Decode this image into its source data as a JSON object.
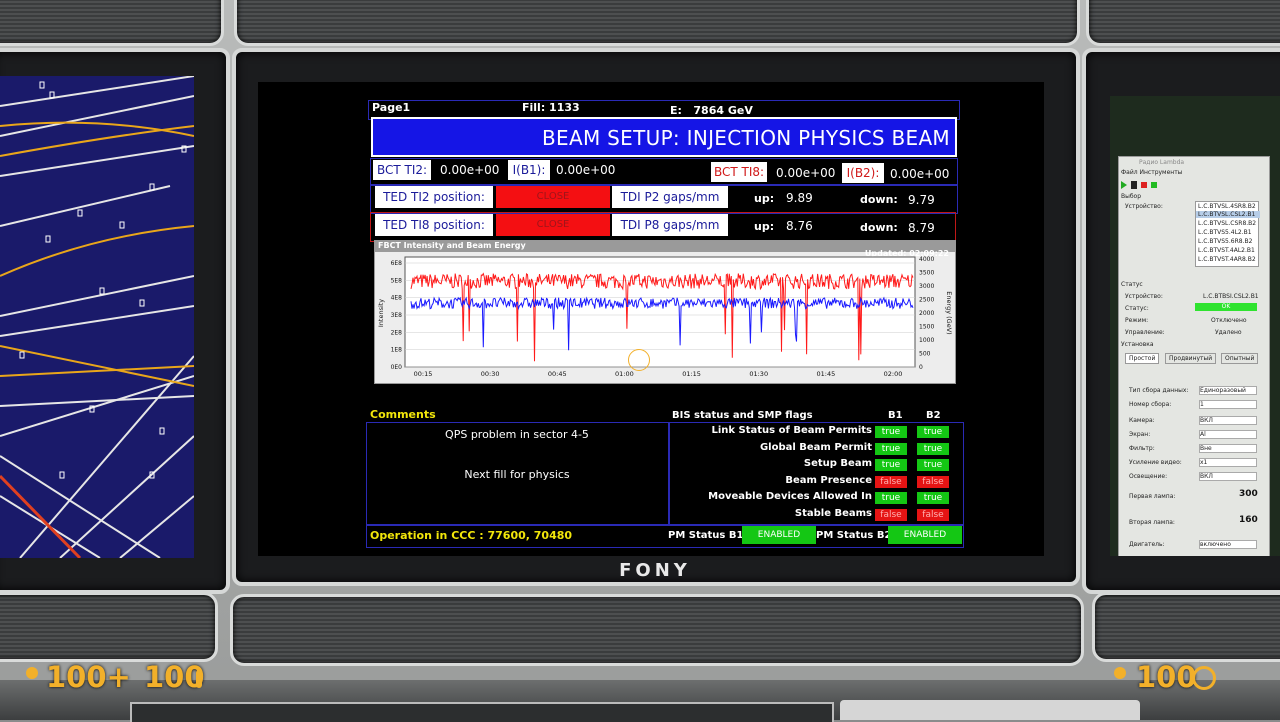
{
  "header": {
    "page": "Page1",
    "fill": "Fill: 1133",
    "energy": "E:   7864 GeV"
  },
  "title": "BEAM SETUP: INJECTION PHYSICS BEAM",
  "bct": {
    "ti2_label": "BCT TI2:",
    "ti2_value": "0.00e+00",
    "ib1_label": "I(B1):",
    "ib1_value": "0.00e+00",
    "ti8_label": "BCT TI8:",
    "ti8_value": "0.00e+00",
    "ib2_label": "I(B2):",
    "ib2_value": "0.00e+00"
  },
  "ted": {
    "ti2_label": "TED TI2 position:",
    "ti2_state": "CLOSE",
    "ti8_label": "TED TI8 position:",
    "ti8_state": "CLOSE",
    "tdi_p2_label": "TDI P2 gaps/mm",
    "tdi_p2_up_label": "up:",
    "tdi_p2_up": "9.89",
    "tdi_p2_down_label": "down:",
    "tdi_p2_down": "9.79",
    "tdi_p8_label": "TDI P8 gaps/mm",
    "tdi_p8_up_label": "up:",
    "tdi_p8_up": "8.76",
    "tdi_p8_down_label": "down:",
    "tdi_p8_down": "8.79"
  },
  "chart_data": {
    "type": "line",
    "title": "FBCT Intensity and Beam Energy",
    "updated": "Updated: 02:09:22",
    "ylabel": "Intensity",
    "y2label": "Energy (GeV)",
    "x_ticks": [
      "00:15",
      "00:30",
      "00:45",
      "01:00",
      "01:15",
      "01:30",
      "01:45",
      "02:00"
    ],
    "y_ticks": [
      "0E0",
      "1E8",
      "2E8",
      "3E8",
      "4E8",
      "5E8",
      "6E8"
    ],
    "y2_ticks": [
      "0",
      "500",
      "1000",
      "1500",
      "2000",
      "2500",
      "3000",
      "3500",
      "4000"
    ],
    "series": [
      {
        "color": "#ff1a1a",
        "level": 0.78,
        "noise": 0.07,
        "dip_rate": 0.12
      },
      {
        "color": "#1a1aff",
        "level": 0.58,
        "noise": 0.05,
        "dip_rate": 0.08
      }
    ]
  },
  "comments": {
    "label": "Comments",
    "line1": "QPS problem in sector 4-5",
    "line2": "Next fill for physics"
  },
  "bis": {
    "title": "BIS status and SMP flags",
    "b1": "B1",
    "b2": "B2",
    "rows": [
      {
        "label": "Link Status of Beam Permits",
        "b1": "true",
        "b2": "true"
      },
      {
        "label": "Global Beam Permit",
        "b1": "true",
        "b2": "true"
      },
      {
        "label": "Setup Beam",
        "b1": "true",
        "b2": "true"
      },
      {
        "label": "Beam Presence",
        "b1": "false",
        "b2": "false"
      },
      {
        "label": "Moveable Devices Allowed In",
        "b1": "true",
        "b2": "true"
      },
      {
        "label": "Stable Beams",
        "b1": "false",
        "b2": "false"
      }
    ]
  },
  "footer": {
    "operation": "Operation in CCC : 77600, 70480",
    "pm_b1_label": "PM Status B1",
    "pm_b1_value": "ENABLED",
    "pm_b2_label": "PM Status B2",
    "pm_b2_value": "ENABLED"
  },
  "monitor_brand": "FONY",
  "hud": {
    "health": "100+",
    "armor": "100",
    "ammo": "100"
  },
  "right_panel": {
    "window_title": "Радио Lambda",
    "menu": "Файл  Инструменты",
    "section_select": "Выбор",
    "device_label": "Устройство:",
    "devices": [
      "L.C.BTVSL.4SR8.B2",
      "L.C.BTVSL.CSL2.B1",
      "L.C.BTVSL.CSR8.B2",
      "L.C.BTVS5.4L2.B1",
      "L.C.BTVS5.6R8.B2",
      "L.C.BTVST.4AL2.B1",
      "L.C.BTVST.4AR8.B2"
    ],
    "status_section": "Статус",
    "status_device_label": "Устройство:",
    "status_device": "L.C.BTBSI.CSL2.B1",
    "status_label": "Статус:",
    "status_value": "OK",
    "mode_label": "Режим:",
    "mode_value": "Отключено",
    "control_label": "Управление:",
    "control_value": "Удалено",
    "setup_section": "Установка",
    "tabs": [
      "Простой",
      "Продвинутый",
      "Опытный"
    ],
    "fields": [
      {
        "label": "Тип сбора данных:",
        "value": "Единоразовый"
      },
      {
        "label": "Номер сбора:",
        "value": "1"
      },
      {
        "label": "Камера:",
        "value": "ВКЛ"
      },
      {
        "label": "Экран:",
        "value": "Al"
      },
      {
        "label": "Фильтр:",
        "value": "Вне"
      },
      {
        "label": "Усиление видео:",
        "value": "x1"
      },
      {
        "label": "Освещение:",
        "value": "ВКЛ"
      }
    ],
    "lamp1_label": "Первая лампа:",
    "lamp1_value": "300",
    "lamp2_label": "Вторая лампа:",
    "lamp2_value": "160",
    "motor_label": "Двигатель:",
    "motor_value": "включено"
  }
}
